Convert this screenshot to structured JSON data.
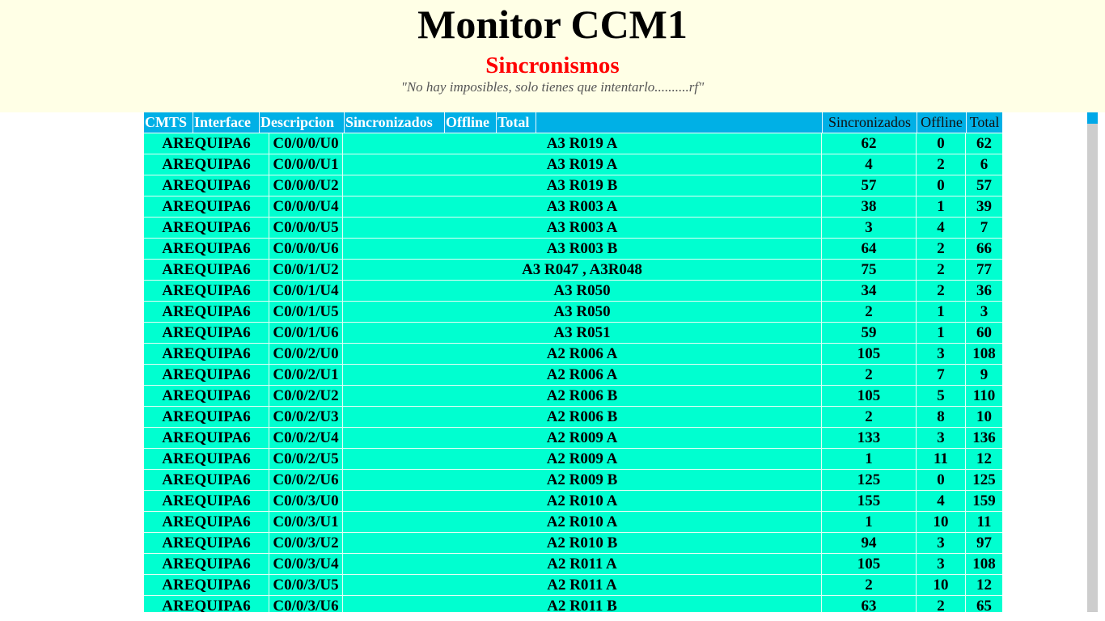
{
  "header": {
    "title": "Monitor CCM1",
    "subtitle": "Sincronismos",
    "quote": "\"No hay imposibles, solo tienes que intentarlo..........rf\""
  },
  "table": {
    "left_headers": [
      "CMTS",
      "Interface",
      "Descripcion",
      "Sincronizados",
      "Offline",
      "Total"
    ],
    "right_headers": [
      "Sincronizados",
      "Offline",
      "Total"
    ],
    "rows": [
      {
        "cmts": "AREQUIPA6",
        "interface": "C0/0/0/U0",
        "descripcion": "A3 R019 A",
        "sincronizados": "62",
        "offline": "0",
        "total": "62"
      },
      {
        "cmts": "AREQUIPA6",
        "interface": "C0/0/0/U1",
        "descripcion": "A3 R019 A",
        "sincronizados": "4",
        "offline": "2",
        "total": "6"
      },
      {
        "cmts": "AREQUIPA6",
        "interface": "C0/0/0/U2",
        "descripcion": "A3 R019 B",
        "sincronizados": "57",
        "offline": "0",
        "total": "57"
      },
      {
        "cmts": "AREQUIPA6",
        "interface": "C0/0/0/U4",
        "descripcion": "A3 R003 A",
        "sincronizados": "38",
        "offline": "1",
        "total": "39"
      },
      {
        "cmts": "AREQUIPA6",
        "interface": "C0/0/0/U5",
        "descripcion": "A3 R003 A",
        "sincronizados": "3",
        "offline": "4",
        "total": "7"
      },
      {
        "cmts": "AREQUIPA6",
        "interface": "C0/0/0/U6",
        "descripcion": "A3 R003 B",
        "sincronizados": "64",
        "offline": "2",
        "total": "66"
      },
      {
        "cmts": "AREQUIPA6",
        "interface": "C0/0/1/U2",
        "descripcion": "A3 R047 , A3R048",
        "sincronizados": "75",
        "offline": "2",
        "total": "77"
      },
      {
        "cmts": "AREQUIPA6",
        "interface": "C0/0/1/U4",
        "descripcion": "A3 R050",
        "sincronizados": "34",
        "offline": "2",
        "total": "36"
      },
      {
        "cmts": "AREQUIPA6",
        "interface": "C0/0/1/U5",
        "descripcion": "A3 R050",
        "sincronizados": "2",
        "offline": "1",
        "total": "3"
      },
      {
        "cmts": "AREQUIPA6",
        "interface": "C0/0/1/U6",
        "descripcion": "A3 R051",
        "sincronizados": "59",
        "offline": "1",
        "total": "60"
      },
      {
        "cmts": "AREQUIPA6",
        "interface": "C0/0/2/U0",
        "descripcion": "A2 R006 A",
        "sincronizados": "105",
        "offline": "3",
        "total": "108"
      },
      {
        "cmts": "AREQUIPA6",
        "interface": "C0/0/2/U1",
        "descripcion": "A2 R006 A",
        "sincronizados": "2",
        "offline": "7",
        "total": "9"
      },
      {
        "cmts": "AREQUIPA6",
        "interface": "C0/0/2/U2",
        "descripcion": "A2 R006 B",
        "sincronizados": "105",
        "offline": "5",
        "total": "110"
      },
      {
        "cmts": "AREQUIPA6",
        "interface": "C0/0/2/U3",
        "descripcion": "A2 R006 B",
        "sincronizados": "2",
        "offline": "8",
        "total": "10"
      },
      {
        "cmts": "AREQUIPA6",
        "interface": "C0/0/2/U4",
        "descripcion": "A2 R009 A",
        "sincronizados": "133",
        "offline": "3",
        "total": "136"
      },
      {
        "cmts": "AREQUIPA6",
        "interface": "C0/0/2/U5",
        "descripcion": "A2 R009 A",
        "sincronizados": "1",
        "offline": "11",
        "total": "12"
      },
      {
        "cmts": "AREQUIPA6",
        "interface": "C0/0/2/U6",
        "descripcion": "A2 R009 B",
        "sincronizados": "125",
        "offline": "0",
        "total": "125"
      },
      {
        "cmts": "AREQUIPA6",
        "interface": "C0/0/3/U0",
        "descripcion": "A2 R010 A",
        "sincronizados": "155",
        "offline": "4",
        "total": "159"
      },
      {
        "cmts": "AREQUIPA6",
        "interface": "C0/0/3/U1",
        "descripcion": "A2 R010 A",
        "sincronizados": "1",
        "offline": "10",
        "total": "11"
      },
      {
        "cmts": "AREQUIPA6",
        "interface": "C0/0/3/U2",
        "descripcion": "A2 R010 B",
        "sincronizados": "94",
        "offline": "3",
        "total": "97"
      },
      {
        "cmts": "AREQUIPA6",
        "interface": "C0/0/3/U4",
        "descripcion": "A2 R011 A",
        "sincronizados": "105",
        "offline": "3",
        "total": "108"
      },
      {
        "cmts": "AREQUIPA6",
        "interface": "C0/0/3/U5",
        "descripcion": "A2 R011 A",
        "sincronizados": "2",
        "offline": "10",
        "total": "12"
      },
      {
        "cmts": "AREQUIPA6",
        "interface": "C0/0/3/U6",
        "descripcion": "A2 R011 B",
        "sincronizados": "63",
        "offline": "2",
        "total": "65"
      }
    ]
  },
  "colors": {
    "header_bg": "#ffffe6",
    "table_header_bg": "#00b0e6",
    "row_bg": "#00ffd0",
    "subtitle": "#ff0000",
    "scroll_thumb": "#00a8e8"
  }
}
